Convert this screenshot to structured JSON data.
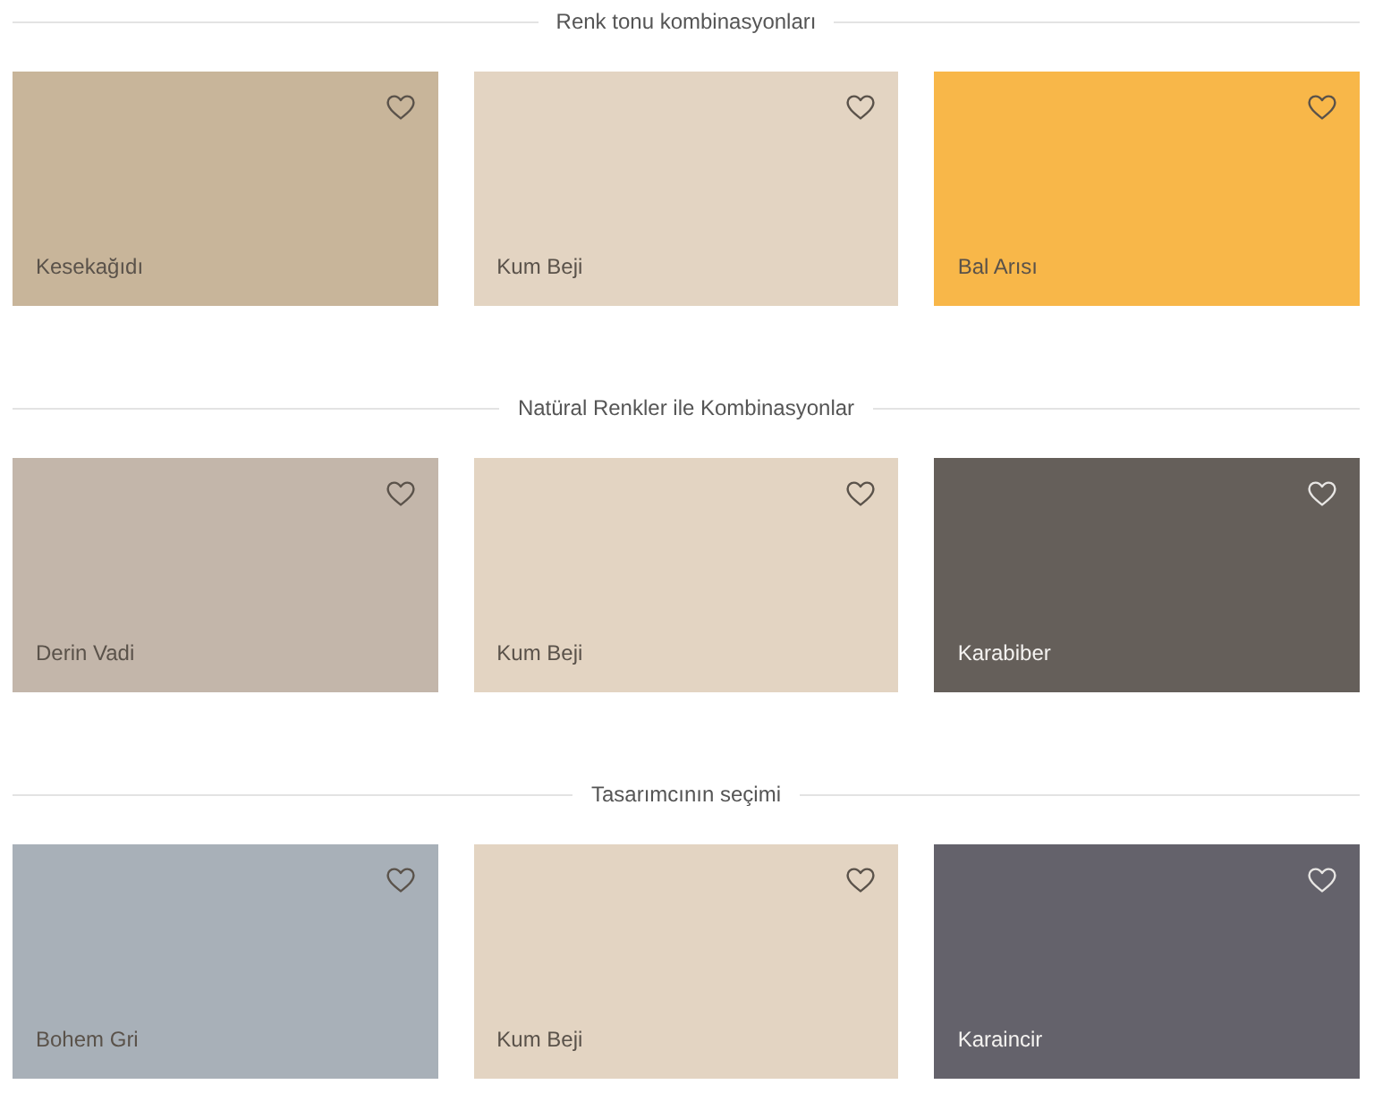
{
  "sections": [
    {
      "title": "Renk tonu kombinasyonları",
      "cards": [
        {
          "name": "Kesekağıdı",
          "color": "#c8b59a",
          "favorited": false
        },
        {
          "name": "Kum Beji",
          "color": "#e3d4c2",
          "favorited": false
        },
        {
          "name": "Bal Arısı",
          "color": "#f8b749",
          "favorited": false
        }
      ]
    },
    {
      "title": "Natüral Renkler ile Kombinasyonlar",
      "cards": [
        {
          "name": "Derin Vadi",
          "color": "#c3b6aa",
          "favorited": false
        },
        {
          "name": "Kum Beji",
          "color": "#e3d4c2",
          "favorited": false
        },
        {
          "name": "Karabiber",
          "color": "#655f5a",
          "favorited": false
        }
      ]
    },
    {
      "title": "Tasarımcının seçimi",
      "cards": [
        {
          "name": "Bohem Gri",
          "color": "#a8b0b8",
          "favorited": false
        },
        {
          "name": "Kum Beji",
          "color": "#e3d4c2",
          "favorited": false
        },
        {
          "name": "Karaincir",
          "color": "#64626b",
          "favorited": false
        }
      ]
    }
  ]
}
